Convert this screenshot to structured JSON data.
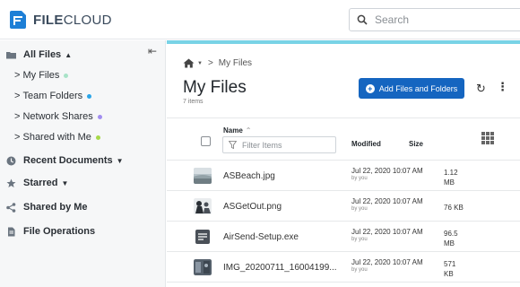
{
  "app": {
    "logo_text_bold": "FILE",
    "logo_text_rest": "CLOUD",
    "brand_color": "#1565c0",
    "accent_color": "#79d3e6"
  },
  "search": {
    "placeholder": "Search",
    "icon": "search-icon"
  },
  "sidebar": {
    "all_files": {
      "label": "All Files",
      "icon": "folder-icon"
    },
    "sub_items": [
      {
        "label": "My Files",
        "dot_color": "#a8e3c8"
      },
      {
        "label": "Team Folders",
        "dot_color": "#2aa5e8"
      },
      {
        "label": "Network Shares",
        "dot_color": "#a28ef0"
      },
      {
        "label": "Shared with Me",
        "dot_color": "#a7d949"
      }
    ],
    "items": [
      {
        "label": "Recent Documents",
        "icon": "clock-icon"
      },
      {
        "label": "Starred",
        "icon": "star-icon"
      },
      {
        "label": "Shared by Me",
        "icon": "share-icon"
      },
      {
        "label": "File Operations",
        "icon": "document-icon"
      }
    ]
  },
  "main": {
    "breadcrumb": {
      "current": "My Files"
    },
    "title": "My Files",
    "item_count": "7 items",
    "add_button_label": "Add Files and Folders",
    "columns": {
      "name": "Name",
      "modified": "Modified",
      "size": "Size"
    },
    "filter_placeholder": "Filter Items",
    "files": [
      {
        "name": "ASBeach.jpg",
        "modified": "Jul 22, 2020 10:07 AM",
        "by": "by you",
        "size_line1": "1.12",
        "size_line2": "MB",
        "thumb": "beach-thumbnail"
      },
      {
        "name": "ASGetOut.png",
        "modified": "Jul 22, 2020 10:07 AM",
        "by": "by you",
        "size_line1": "76 KB",
        "size_line2": "",
        "thumb": "people-thumbnail"
      },
      {
        "name": "AirSend-Setup.exe",
        "modified": "Jul 22, 2020 10:07 AM",
        "by": "by you",
        "size_line1": "96.5",
        "size_line2": "MB",
        "thumb": "document-icon"
      },
      {
        "name": "IMG_20200711_16004199...",
        "modified": "Jul 22, 2020 10:07 AM",
        "by": "by you",
        "size_line1": "571",
        "size_line2": "KB",
        "thumb": "photo-thumbnail"
      }
    ]
  }
}
